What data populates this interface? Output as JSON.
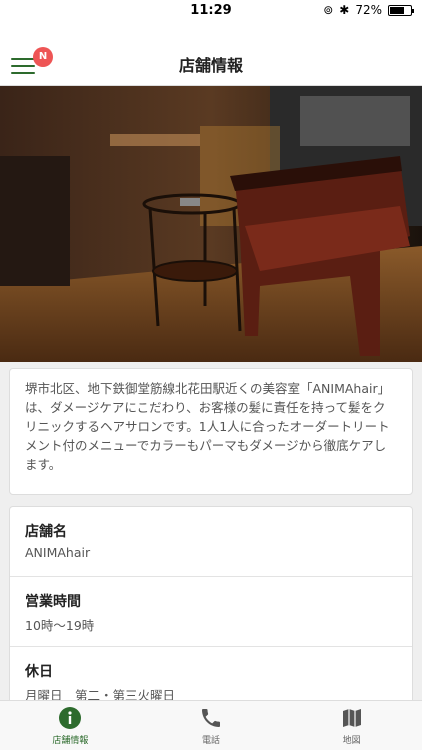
{
  "status": {
    "time": "11:29",
    "battery": "72%"
  },
  "nav": {
    "title": "店舗情報",
    "badge": "N"
  },
  "description": "堺市北区、地下鉄御堂筋線北花田駅近くの美容室「ANIMAhair」は、ダメージケアにこだわり、お客様の髪に責任を持って髪をクリニックするヘアサロンです。1人1人に合ったオーダートリートメント付のメニューでカラーもパーマもダメージから徹底ケアします。",
  "info": [
    {
      "label": "店舗名",
      "value": "ANIMAhair"
    },
    {
      "label": "営業時間",
      "value": "10時〜19時"
    },
    {
      "label": "休日",
      "value": "月曜日　第二・第三火曜日"
    }
  ],
  "tabs": [
    {
      "label": "店舗情報",
      "icon": "info-icon",
      "active": true
    },
    {
      "label": "電話",
      "icon": "phone-icon",
      "active": false
    },
    {
      "label": "地図",
      "icon": "map-icon",
      "active": false
    }
  ],
  "colors": {
    "accent": "#2d6b2d",
    "badge": "#e55555"
  }
}
